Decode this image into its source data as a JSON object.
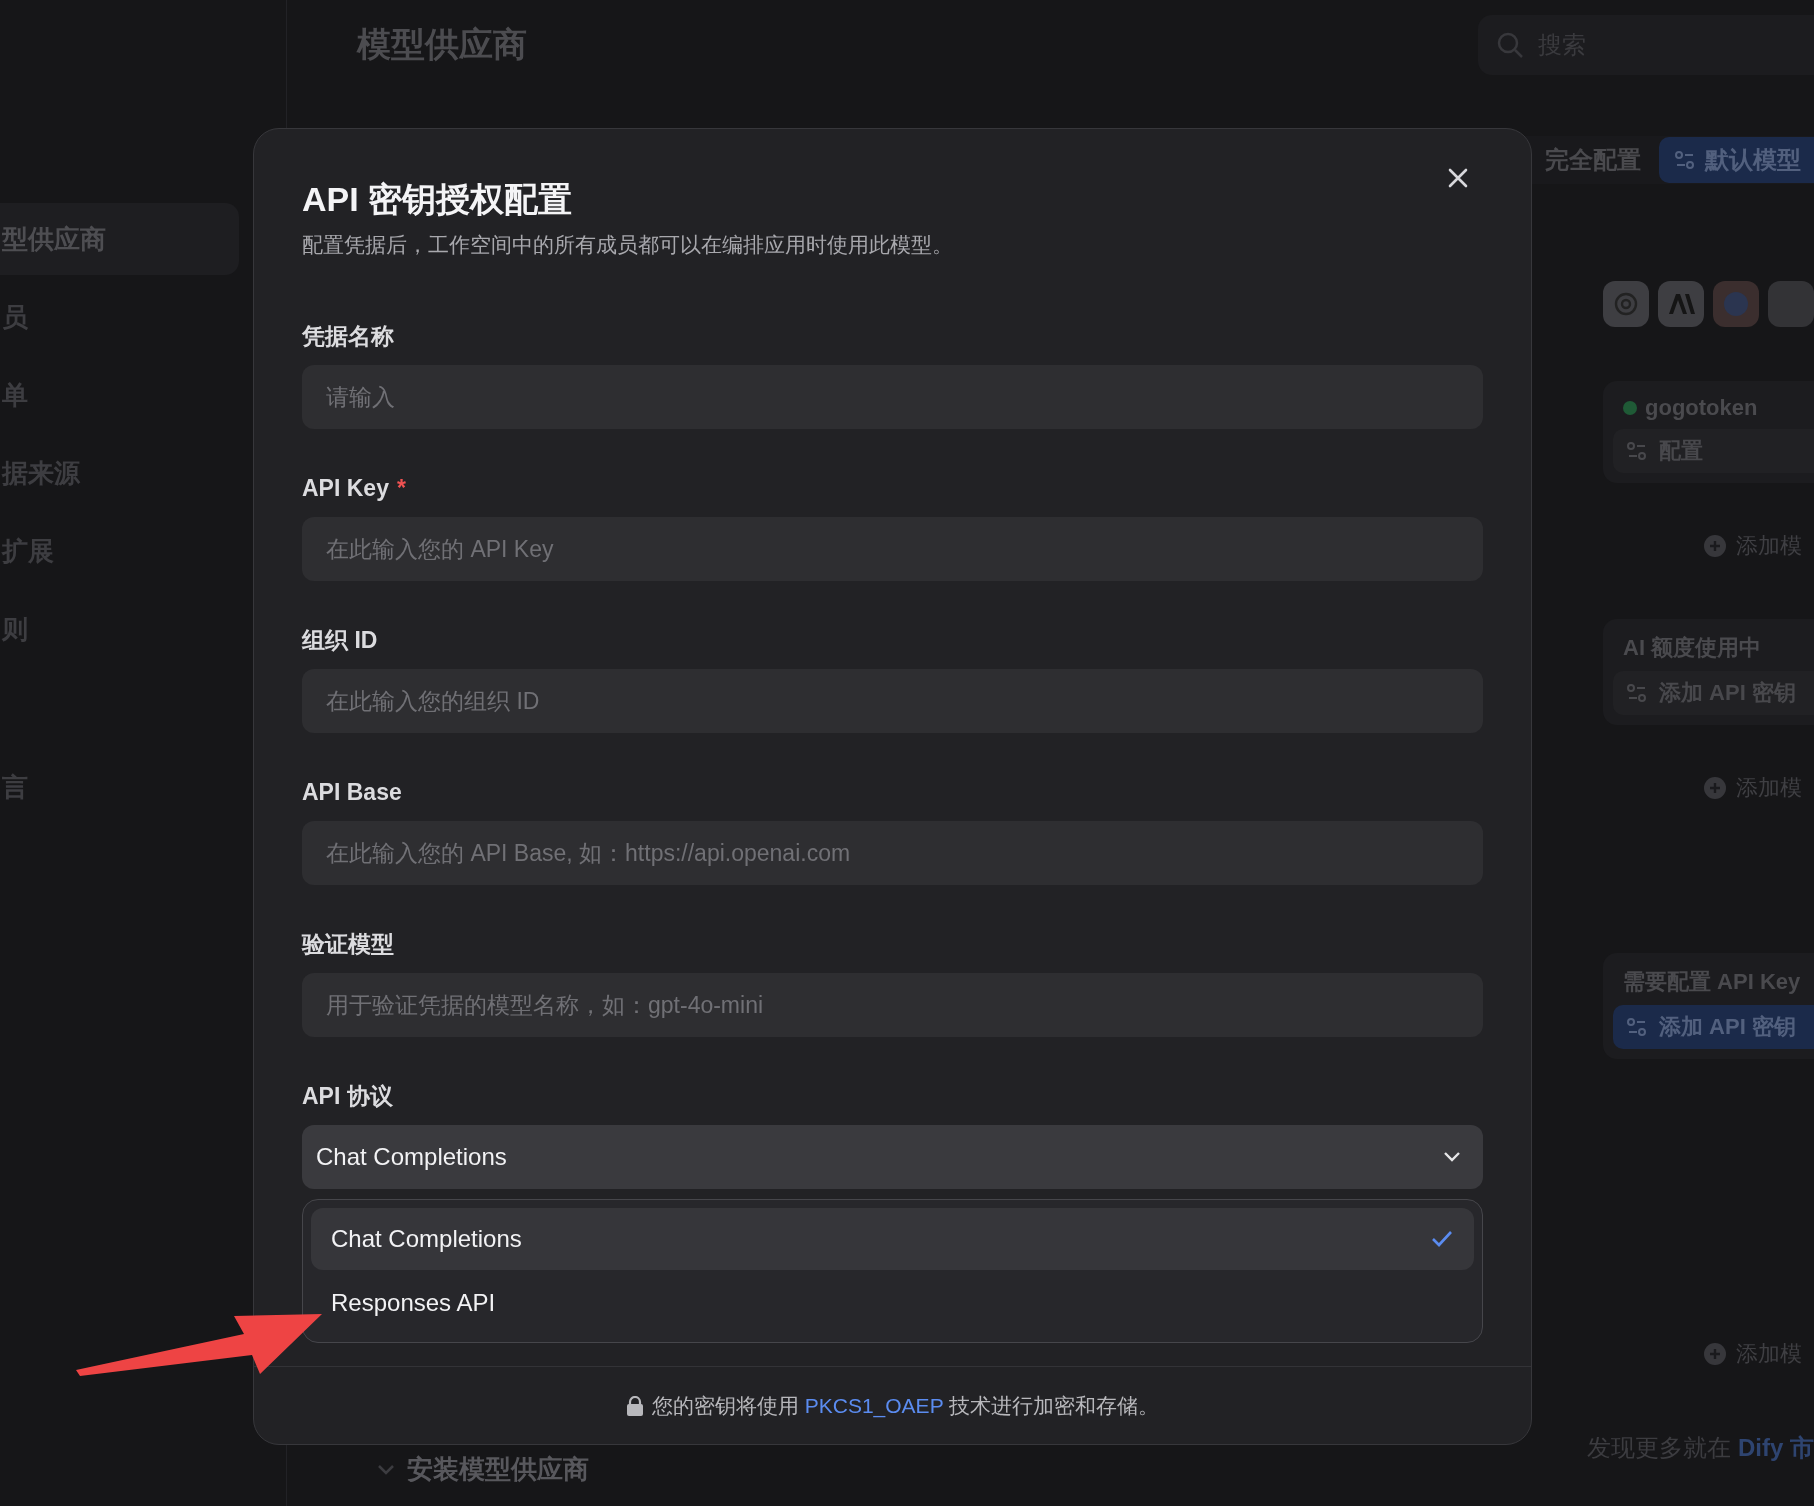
{
  "sidebar": {
    "items": [
      {
        "label": "型供应商",
        "selected": true
      },
      {
        "label": "员",
        "selected": false
      },
      {
        "label": "单",
        "selected": false
      },
      {
        "label": "据来源",
        "selected": false
      },
      {
        "label": "扩展",
        "selected": false
      },
      {
        "label": "则",
        "selected": false
      },
      {
        "label": "言",
        "selected": false
      }
    ]
  },
  "header": {
    "title": "模型供应商",
    "search": {
      "placeholder": "搜索"
    }
  },
  "toolbar": {
    "status": "完全配置",
    "default_model_button": "默认模型"
  },
  "providers": [
    {
      "kind": "configured",
      "name": "gogotoken",
      "action": "配置",
      "add_model": "添加模"
    },
    {
      "kind": "quota",
      "name": "AI 额度使用中",
      "action": "添加 API 密钥",
      "add_model": "添加模"
    },
    {
      "kind": "needs_key",
      "name": "需要配置 API Key",
      "action": "添加 API 密钥",
      "add_model": "添加模"
    }
  ],
  "install_section": {
    "title": "安装模型供应商",
    "discover_text": "发现更多就在",
    "marketplace_link": "Dify 市"
  },
  "modal": {
    "title": "API 密钥授权配置",
    "subtitle": "配置凭据后，工作空间中的所有成员都可以在编排应用时使用此模型。",
    "fields": [
      {
        "label": "凭据名称",
        "required": false,
        "placeholder": "请输入"
      },
      {
        "label": "API Key",
        "required": true,
        "placeholder": "在此输入您的 API Key"
      },
      {
        "label": "组织 ID",
        "required": false,
        "placeholder": "在此输入您的组织 ID"
      },
      {
        "label": "API Base",
        "required": false,
        "placeholder": "在此输入您的 API Base, 如：https://api.openai.com"
      },
      {
        "label": "验证模型",
        "required": false,
        "placeholder": "用于验证凭据的模型名称，如：gpt-4o-mini"
      }
    ],
    "protocol": {
      "label": "API 协议",
      "value": "Chat Completions",
      "expanded": true,
      "options": [
        {
          "label": "Chat Completions",
          "selected": true
        },
        {
          "label": "Responses API",
          "selected": false
        }
      ]
    },
    "required_mark": "*",
    "note": {
      "before": "您的密钥将使用",
      "link": "PKCS1_OAEP",
      "after": "技术进行加密和存储。"
    }
  }
}
